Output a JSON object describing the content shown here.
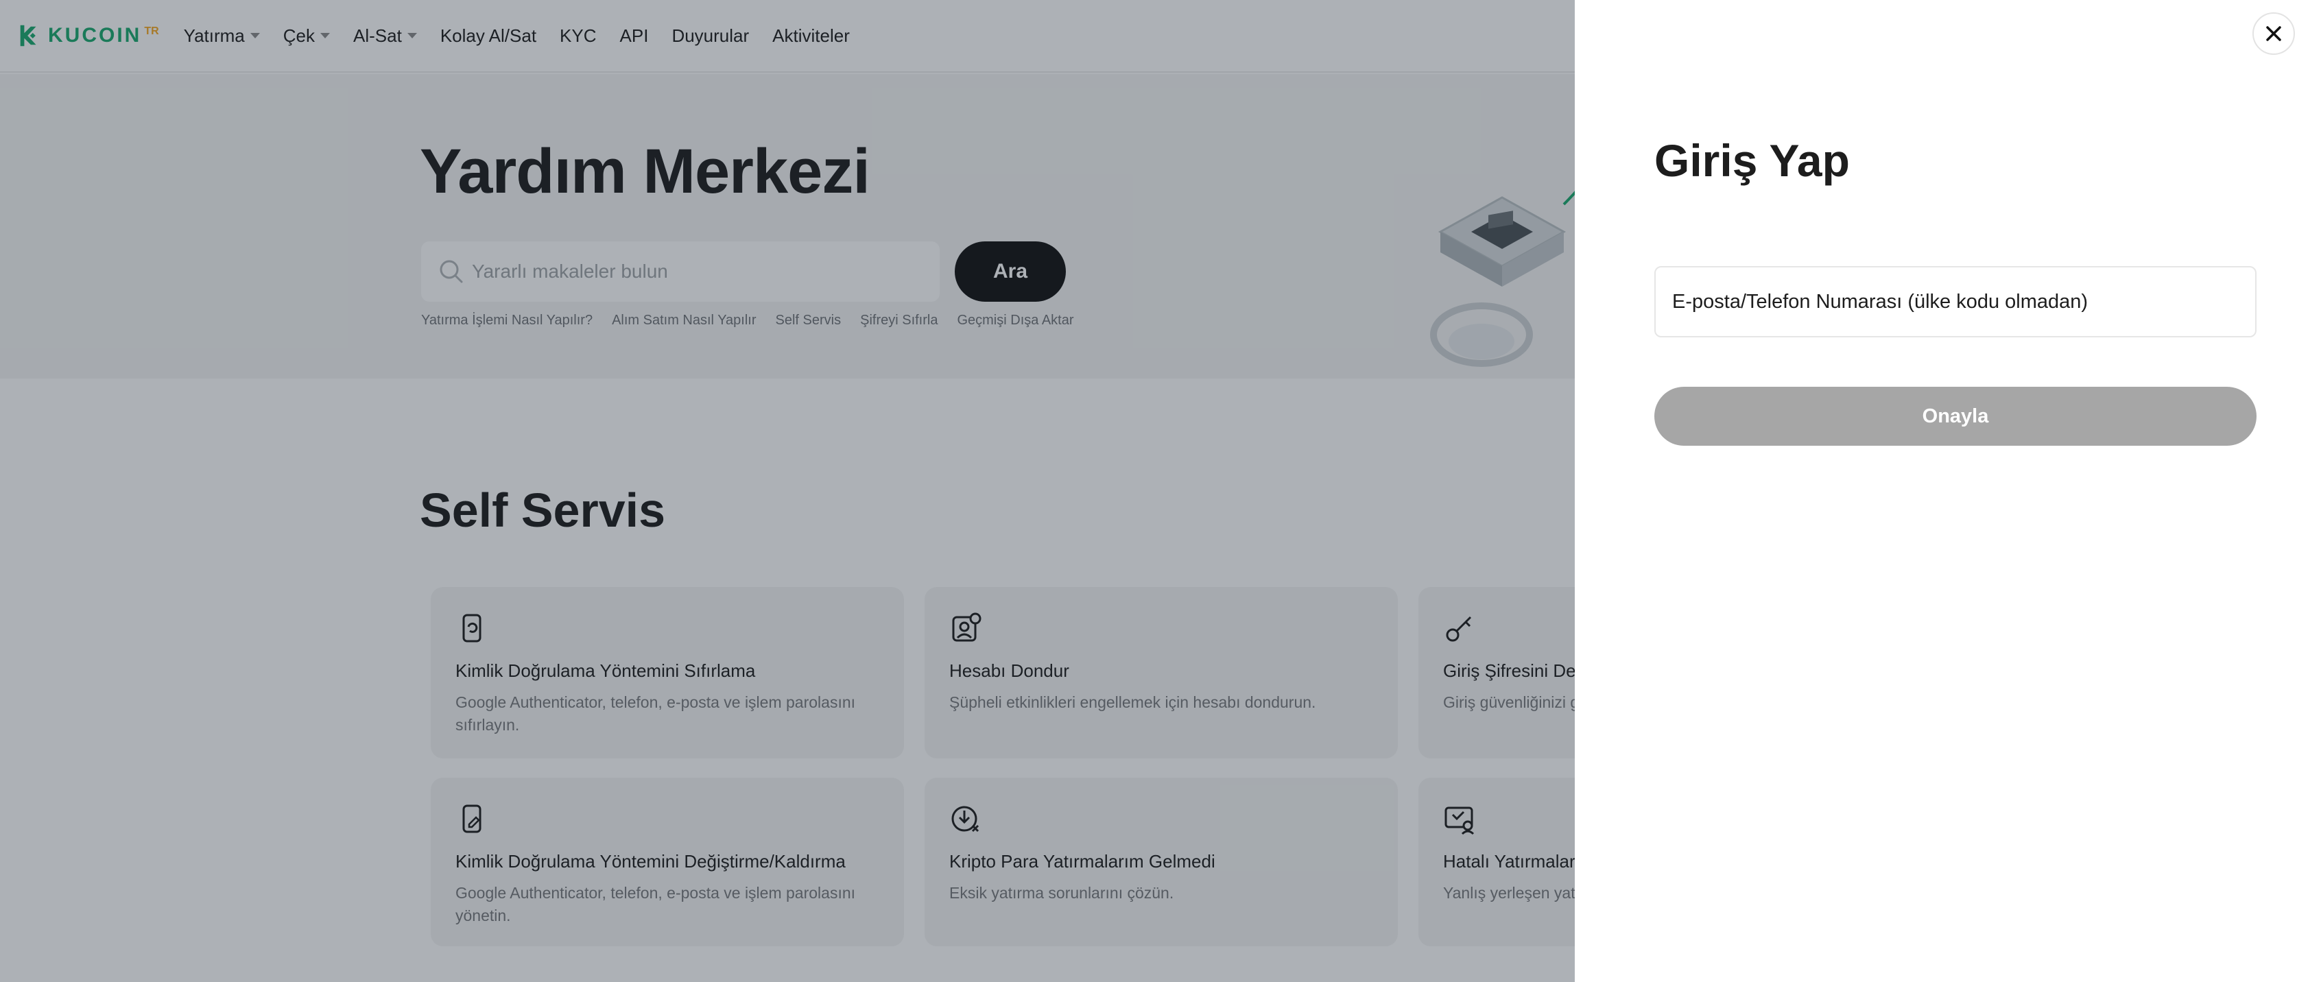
{
  "navbar": {
    "logo_text": "KUCOIN",
    "logo_sup": "TR",
    "items": [
      {
        "label": "Yatırma",
        "dropdown": true
      },
      {
        "label": "Çek",
        "dropdown": true
      },
      {
        "label": "Al-Sat",
        "dropdown": true
      },
      {
        "label": "Kolay Al/Sat",
        "dropdown": false
      },
      {
        "label": "KYC",
        "dropdown": false
      },
      {
        "label": "API",
        "dropdown": false
      },
      {
        "label": "Duyurular",
        "dropdown": false
      },
      {
        "label": "Aktiviteler",
        "dropdown": false
      }
    ]
  },
  "hero": {
    "title": "Yardım Merkezi",
    "search_placeholder": "Yararlı makaleler bulun",
    "search_button": "Ara",
    "quick_links": [
      "Yatırma İşlemi Nasıl Yapılır?",
      "Alım Satım Nasıl Yapılır",
      "Self Servis",
      "Şifreyi Sıfırla",
      "Geçmişi Dışa Aktar"
    ]
  },
  "self_service": {
    "title": "Self Servis",
    "cards": [
      {
        "icon": "phone-reset-icon",
        "title": "Kimlik Doğrulama Yöntemini Sıfırlama",
        "desc": "Google Authenticator, telefon, e-posta ve işlem parolasını sıfırlayın."
      },
      {
        "icon": "user-freeze-icon",
        "title": "Hesabı Dondur",
        "desc": "Şüpheli etkinlikleri engellemek için hesabı dondurun."
      },
      {
        "icon": "key-icon",
        "title": "Giriş Şifresini Değ",
        "desc": "Giriş güvenliğinizi g"
      },
      {
        "icon": "phone-edit-icon",
        "title": "Kimlik Doğrulama Yöntemini Değiştirme/Kaldırma",
        "desc": "Google Authenticator, telefon, e-posta ve işlem parolasını yönetin."
      },
      {
        "icon": "deposit-missing-icon",
        "title": "Kripto Para Yatırmalarım Gelmedi",
        "desc": "Eksik yatırma sorunlarını çözün."
      },
      {
        "icon": "wrong-deposit-icon",
        "title": "Hatalı Yatırmaları",
        "desc": "Yanlış yerleşen yat"
      }
    ]
  },
  "login_drawer": {
    "title": "Giriş Yap",
    "input_placeholder": "E-posta/Telefon Numarası (ülke kodu olmadan)",
    "confirm_button": "Onayla"
  },
  "colors": {
    "brand_green": "#1aaa6e",
    "overlay": "rgba(28,40,52,0.36)",
    "disabled_button": "#a6a6a6",
    "dark_button": "#121212"
  }
}
